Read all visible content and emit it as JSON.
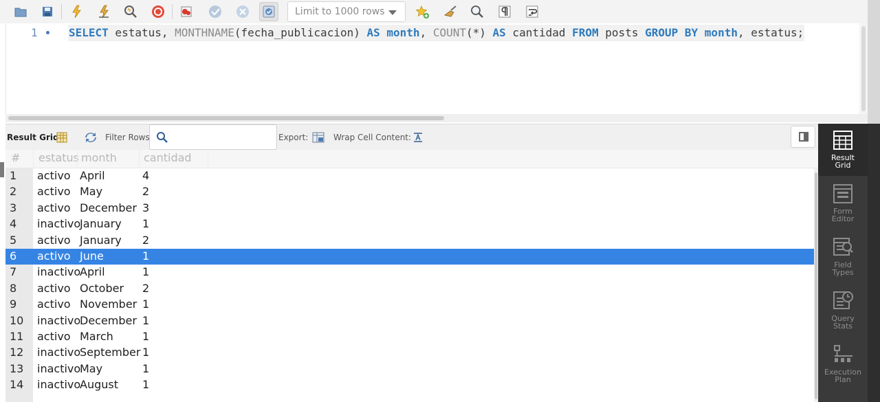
{
  "toolbar": {
    "limit_select_value": "Limit to 1000 rows",
    "buttons": [
      "open-folder-icon",
      "save-icon",
      "execute-icon",
      "execute-current-icon",
      "explain-icon",
      "stop-icon",
      "stop-on-error-icon",
      "commit-icon",
      "rollback-icon",
      "autocommit-icon",
      "add-snippet-icon",
      "beautify-icon",
      "find-icon",
      "invisible-chars-icon",
      "wrap-lines-icon"
    ]
  },
  "editor": {
    "line_number": "1",
    "sql": {
      "t1": "SELECT",
      "t2": " estatus, ",
      "t3": "MONTHNAME",
      "t4": "(fecha_publicacion) ",
      "t5": "AS",
      "t6": " ",
      "t7": "month",
      "t8": ", ",
      "t9": "COUNT",
      "t10": "(*) ",
      "t11": "AS",
      "t12": " cantidad ",
      "t13": "FROM",
      "t14": " posts ",
      "t15": "GROUP BY",
      "t16": " ",
      "t17": "month",
      "t18": ", estatus;"
    }
  },
  "result_toolbar": {
    "result_grid_label": "Result Grid",
    "filter_rows_label": "Filter Rows:",
    "filter_value": "",
    "export_label": "Export:",
    "wrap_label": "Wrap Cell Content:"
  },
  "grid": {
    "columns": [
      "#",
      "estatus",
      "month",
      "cantidad"
    ],
    "selected_row": 6,
    "rows": [
      {
        "n": "1",
        "estatus": "activo",
        "month": "April",
        "cantidad": "4"
      },
      {
        "n": "2",
        "estatus": "activo",
        "month": "May",
        "cantidad": "2"
      },
      {
        "n": "3",
        "estatus": "activo",
        "month": "December",
        "cantidad": "3"
      },
      {
        "n": "4",
        "estatus": "inactivo",
        "month": "January",
        "cantidad": "1"
      },
      {
        "n": "5",
        "estatus": "activo",
        "month": "January",
        "cantidad": "2"
      },
      {
        "n": "6",
        "estatus": "activo",
        "month": "June",
        "cantidad": "1"
      },
      {
        "n": "7",
        "estatus": "inactivo",
        "month": "April",
        "cantidad": "1"
      },
      {
        "n": "8",
        "estatus": "activo",
        "month": "October",
        "cantidad": "2"
      },
      {
        "n": "9",
        "estatus": "activo",
        "month": "November",
        "cantidad": "1"
      },
      {
        "n": "10",
        "estatus": "inactivo",
        "month": "December",
        "cantidad": "1"
      },
      {
        "n": "11",
        "estatus": "activo",
        "month": "March",
        "cantidad": "1"
      },
      {
        "n": "12",
        "estatus": "inactivo",
        "month": "September",
        "cantidad": "1"
      },
      {
        "n": "13",
        "estatus": "inactivo",
        "month": "May",
        "cantidad": "1"
      },
      {
        "n": "14",
        "estatus": "inactivo",
        "month": "August",
        "cantidad": "1"
      }
    ]
  },
  "side_panel": {
    "items": [
      {
        "line1": "Result",
        "line2": "Grid",
        "icon": "result-grid-icon"
      },
      {
        "line1": "Form",
        "line2": "Editor",
        "icon": "form-editor-icon"
      },
      {
        "line1": "Field",
        "line2": "Types",
        "icon": "field-types-icon"
      },
      {
        "line1": "Query",
        "line2": "Stats",
        "icon": "query-stats-icon"
      },
      {
        "line1": "Execution",
        "line2": "Plan",
        "icon": "execution-plan-icon"
      }
    ]
  },
  "colors": {
    "keyword": "#2f7bbd",
    "selection": "#3584e4",
    "side_panel_bg": "#3a3a3a"
  }
}
